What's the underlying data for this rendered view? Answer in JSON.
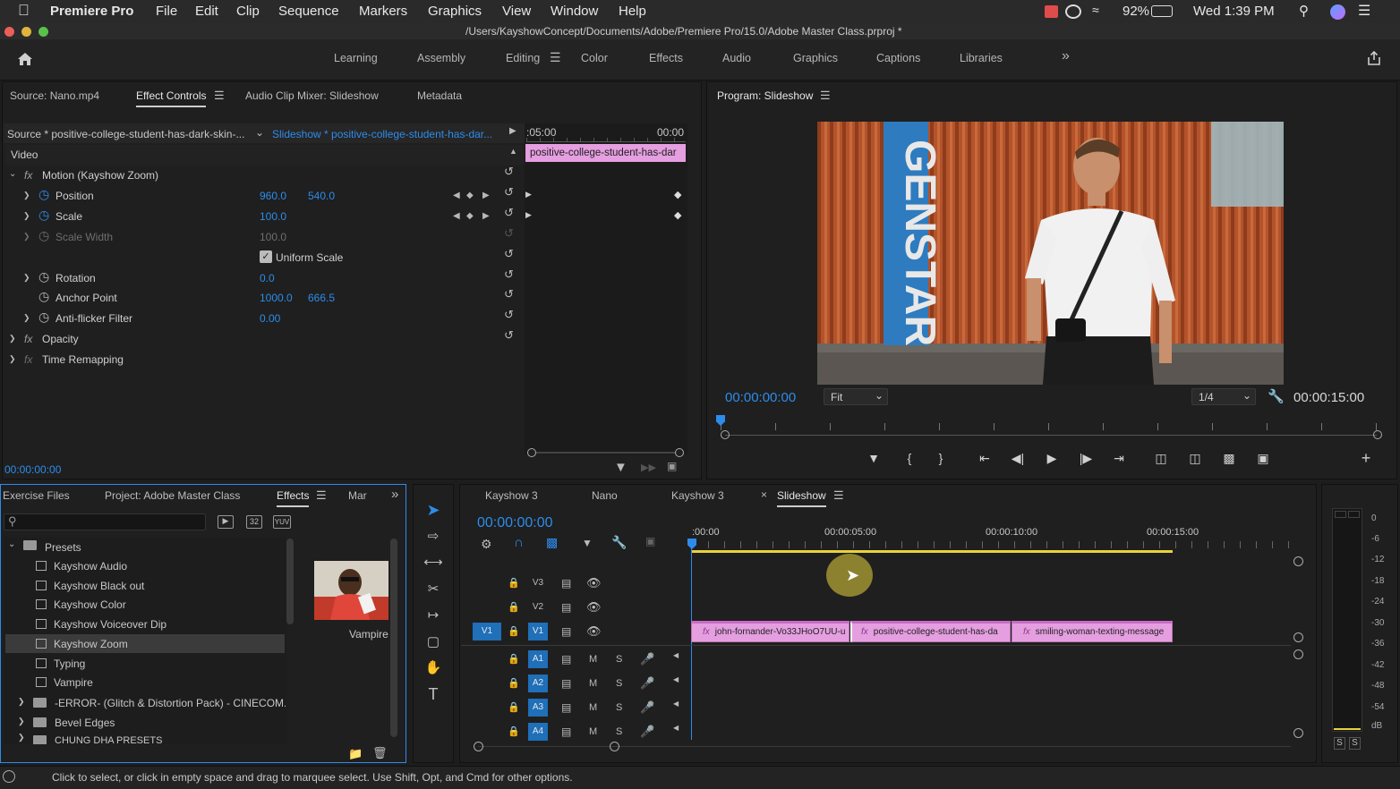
{
  "menubar": {
    "apple": "",
    "app": "Premiere Pro",
    "items": [
      "File",
      "Edit",
      "Clip",
      "Sequence",
      "Markers",
      "Graphics",
      "View",
      "Window",
      "Help"
    ],
    "battery": "92%",
    "clock": "Wed 1:39 PM"
  },
  "titlebar": {
    "path": "/Users/KayshowConcept/Documents/Adobe/Premiere Pro/15.0/Adobe Master Class.prproj *"
  },
  "workspaces": {
    "items": [
      "Learning",
      "Assembly",
      "Editing",
      "Color",
      "Effects",
      "Audio",
      "Graphics",
      "Captions",
      "Libraries"
    ],
    "active": "Editing",
    "more": "»"
  },
  "source_panel": {
    "tabs": [
      "Source: Nano.mp4",
      "Effect Controls",
      "Audio Clip Mixer: Slideshow",
      "Metadata"
    ],
    "source_label": "Source * positive-college-student-has-dark-skin-...",
    "sequence_label": "Slideshow * positive-college-student-has-dar...",
    "timeline_start": ":05:00",
    "timeline_end": "00:00",
    "clip_label": "positive-college-student-has-dar",
    "section_video": "Video",
    "motion": "Motion (Kayshow Zoom)",
    "position": {
      "label": "Position",
      "x": "960.0",
      "y": "540.0"
    },
    "scale": {
      "label": "Scale",
      "value": "100.0"
    },
    "scale_width": {
      "label": "Scale Width",
      "value": "100.0"
    },
    "uniform_scale": "Uniform Scale",
    "rotation": {
      "label": "Rotation",
      "value": "0.0"
    },
    "anchor": {
      "label": "Anchor Point",
      "x": "1000.0",
      "y": "666.5"
    },
    "antiflicker": {
      "label": "Anti-flicker Filter",
      "value": "0.00"
    },
    "opacity": "Opacity",
    "time_remap": "Time Remapping",
    "timecode": "00:00:00:00"
  },
  "program": {
    "title": "Program: Slideshow",
    "timecode": "00:00:00:00",
    "fit": "Fit",
    "quality": "1/4",
    "duration": "00:00:15:00",
    "image_text": "GENSTAR"
  },
  "project": {
    "tabs": [
      "Exercise Files",
      "Project: Adobe Master Class",
      "Effects",
      "Mar"
    ],
    "active": "Effects",
    "presets_label": "Presets",
    "items": [
      "Kayshow Audio",
      "Kayshow Black out",
      "Kayshow Color",
      "Kayshow Voiceover Dip",
      "Kayshow Zoom",
      "Typing",
      "Vampire"
    ],
    "selected": "Kayshow Zoom",
    "folders": [
      "-ERROR- (Glitch & Distortion Pack) - CINECOM.N",
      "Bevel Edges",
      "CHUNG DHA PRESETS"
    ],
    "preview_label": "Vampire",
    "icon_labels": [
      "32",
      "YUV"
    ]
  },
  "timeline": {
    "tabs": [
      "Kayshow 3",
      "Nano",
      "Kayshow 3",
      "Slideshow"
    ],
    "active": "Slideshow",
    "timecode": "00:00:00:00",
    "ruler": [
      ":00:00",
      "00:00:05:00",
      "00:00:10:00",
      "00:00:15:00"
    ],
    "video_tracks": [
      "V3",
      "V2",
      "V1"
    ],
    "audio_tracks": [
      "A1",
      "A2",
      "A3",
      "A4"
    ],
    "src_patch": "V1",
    "m_label": "M",
    "s_label": "S",
    "clips": [
      {
        "name": "john-fornander-Vo33JHoO7UU-u"
      },
      {
        "name": "positive-college-student-has-da"
      },
      {
        "name": "smiling-woman-texting-message"
      }
    ]
  },
  "meter": {
    "scale": [
      "0",
      "-6",
      "-12",
      "-18",
      "-24",
      "-30",
      "-36",
      "-42",
      "-48",
      "-54",
      "dB"
    ],
    "solo": [
      "S",
      "S"
    ]
  },
  "status": {
    "text": "Click to select, or click in empty space and drag to marquee select. Use Shift, Opt, and Cmd for other options."
  },
  "colors": {
    "accent": "#2d8ceb",
    "clip": "#e59ee0",
    "workarea": "#e8d23a"
  }
}
